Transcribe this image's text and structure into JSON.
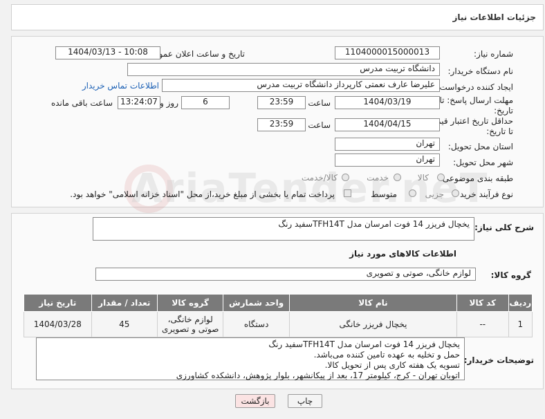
{
  "header": {
    "title": "جزئیات اطلاعات نیاز"
  },
  "form": {
    "need_number_label": "شماره نیاز:",
    "need_number": "1104000015000013",
    "announce_label": "تاریخ و ساعت اعلان عمومی:",
    "announce_value": "1404/03/13 - 10:08",
    "buyer_org_label": "نام دستگاه خریدار:",
    "buyer_org": "دانشگاه تربیت مدرس",
    "creator_label": "ایجاد کننده درخواست:",
    "creator": "علیرضا عارف نعمتی کارپرداز دانشگاه تربیت مدرس",
    "contact_link": "اطلاعات تماس خریدار",
    "deadline_label_1": "مهلت ارسال پاسخ: تا",
    "deadline_label_2": "تاریخ:",
    "deadline_date": "1404/03/19",
    "time_label": "ساعت",
    "deadline_time": "23:59",
    "days_value": "6",
    "days_label": "روز و",
    "remaining_time": "13:24:07",
    "remaining_label": "ساعت باقی مانده",
    "validity_label_1": "حداقل تاریخ اعتبار قیمت:",
    "validity_label_2": "تا تاریخ:",
    "validity_date": "1404/04/15",
    "validity_time": "23:59",
    "province_label": "استان محل تحویل:",
    "province": "تهران",
    "city_label": "شهر محل تحویل:",
    "city": "تهران",
    "category_label": "طبقه بندی موضوعی:",
    "category_options": [
      "کالا",
      "خدمت",
      "کالا/خدمت"
    ],
    "process_label": "نوع فرآیند خرید :",
    "process_options": [
      "جزیی",
      "متوسط"
    ],
    "payment_note": "پرداخت تمام یا بخشی از مبلغ خرید،از محل \"اسناد خزانه اسلامی\" خواهد بود."
  },
  "summary": {
    "label": "شرح کلی نیاز:",
    "value": "یخچال فریزر 14 فوت امرسان مدل TFH14Tسفید رنگ"
  },
  "goods": {
    "section_title": "اطلاعات کالاهای مورد نیاز",
    "group_label": "گروه کالا:",
    "group_value": "لوازم خانگی، صوتی و تصویری",
    "columns": [
      "ردیف",
      "کد کالا",
      "نام کالا",
      "واحد شمارش",
      "گروه کالا",
      "تعداد / مقدار",
      "تاریخ نیاز"
    ],
    "rows": [
      {
        "row": "1",
        "code": "--",
        "name": "یخچال فریزر خانگی",
        "unit": "دستگاه",
        "group": "لوازم خانگی، صوتی و تصویری",
        "qty": "45",
        "date": "1404/03/28"
      }
    ]
  },
  "buyer_notes": {
    "label": "توضیحات خریدار:",
    "lines": [
      "یخچال فریزر 14 فوت امرسان مدل TFH14Tسفید رنگ",
      "حمل و تخلیه به عهده تامین کننده می‌باشد.",
      "تسویه یک هفته کاری پس از تحویل کالا.",
      "اتوبان تهران - کرج، کیلومتر 17، بعد از پیکانشهر، بلوار پژوهش، دانشکده کشاورزی"
    ]
  },
  "buttons": {
    "print": "چاپ",
    "back": "بازگشت"
  },
  "watermark": "AriaTender.neT",
  "colors": {
    "link": "#1a5fb4",
    "table_header": "#7a7a7a",
    "back_button": "#fbe3e3"
  }
}
